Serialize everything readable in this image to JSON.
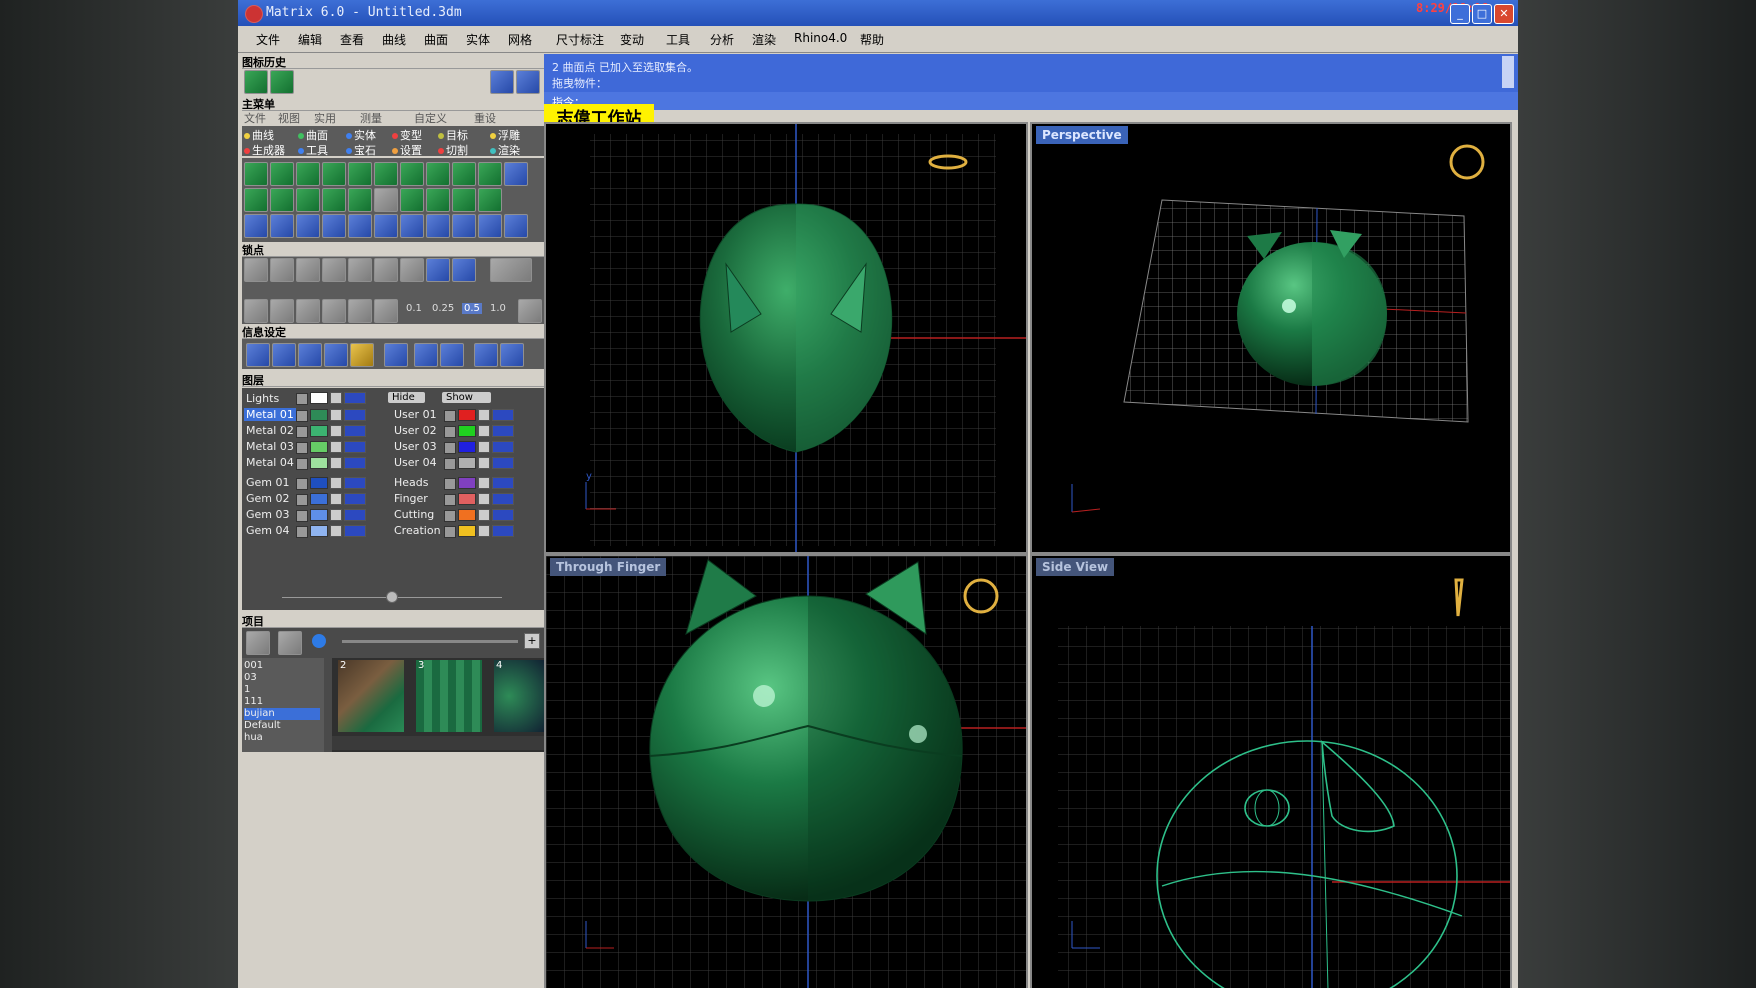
{
  "window": {
    "title": "Matrix 6.0 - Untitled.3dm",
    "clock": "8:29/18:06",
    "buttons": [
      "minimize",
      "maximize",
      "close"
    ]
  },
  "menu": [
    "文件",
    "编辑",
    "查看",
    "曲线",
    "曲面",
    "实体",
    "网格",
    "尺寸标注",
    "变动",
    "工具",
    "分析",
    "渲染",
    "Rhino4.0",
    "帮助"
  ],
  "left_panel": {
    "history_title": "图标历史",
    "main_menu_title": "主菜单",
    "tabs": [
      "文件",
      "视图",
      "实用",
      "测量",
      "自定义",
      "重设"
    ],
    "categories": [
      {
        "label": "曲线",
        "color": "#f0d040"
      },
      {
        "label": "曲面",
        "color": "#40c060"
      },
      {
        "label": "实体",
        "color": "#4080f0"
      },
      {
        "label": "变型",
        "color": "#f04040"
      },
      {
        "label": "目标",
        "color": "#c0c040"
      },
      {
        "label": "浮雕",
        "color": "#f0d040"
      },
      {
        "label": "生成器",
        "color": "#f04040"
      },
      {
        "label": "工具",
        "color": "#4080f0"
      },
      {
        "label": "宝石",
        "color": "#4080f0"
      },
      {
        "label": "设置",
        "color": "#f0a040"
      },
      {
        "label": "切割",
        "color": "#f04040"
      },
      {
        "label": "渲染",
        "color": "#40c0c0"
      }
    ],
    "snap_title": "锁点",
    "snap_values": [
      "0.1",
      "0.25",
      "0.5",
      "1.0"
    ],
    "info_title": "信息设定",
    "layers_title": "图层",
    "lights_label": "Lights",
    "hide_label": "Hide",
    "show_label": "Show",
    "layers_left": [
      {
        "name": "Metal 01",
        "color": "#2e8b57",
        "selected": true
      },
      {
        "name": "Metal 02",
        "color": "#3cb371"
      },
      {
        "name": "Metal 03",
        "color": "#66cd66"
      },
      {
        "name": "Metal 04",
        "color": "#9ee09e"
      },
      {
        "name": "Gem 01",
        "color": "#1f4fbf"
      },
      {
        "name": "Gem 02",
        "color": "#3b6fd8"
      },
      {
        "name": "Gem 03",
        "color": "#5f8fe8"
      },
      {
        "name": "Gem 04",
        "color": "#8fb4f0"
      }
    ],
    "layers_right": [
      {
        "name": "User 01",
        "color": "#e02020"
      },
      {
        "name": "User 02",
        "color": "#20d020"
      },
      {
        "name": "User 03",
        "color": "#2020e0"
      },
      {
        "name": "User 04",
        "color": "#b0b0b0"
      },
      {
        "name": "Heads",
        "color": "#8040c0"
      },
      {
        "name": "Finger",
        "color": "#e06060"
      },
      {
        "name": "Cutting",
        "color": "#f07020"
      },
      {
        "name": "Creation",
        "color": "#f0c020"
      }
    ],
    "project_title": "项目",
    "project_items": [
      "001",
      "03",
      "1",
      "111",
      "bujian",
      "Default",
      "hua"
    ],
    "project_selected": "bujian",
    "thumbnails": [
      "2",
      "3",
      "4"
    ]
  },
  "command": {
    "line1": "2 曲面点 已加入至选取集合。",
    "line2": "拖曳物件：",
    "prompt": "指令："
  },
  "logo_text": "志偉工作站",
  "viewports": {
    "top": "",
    "perspective": "Perspective",
    "front": "Through Finger",
    "side": "Side View"
  }
}
